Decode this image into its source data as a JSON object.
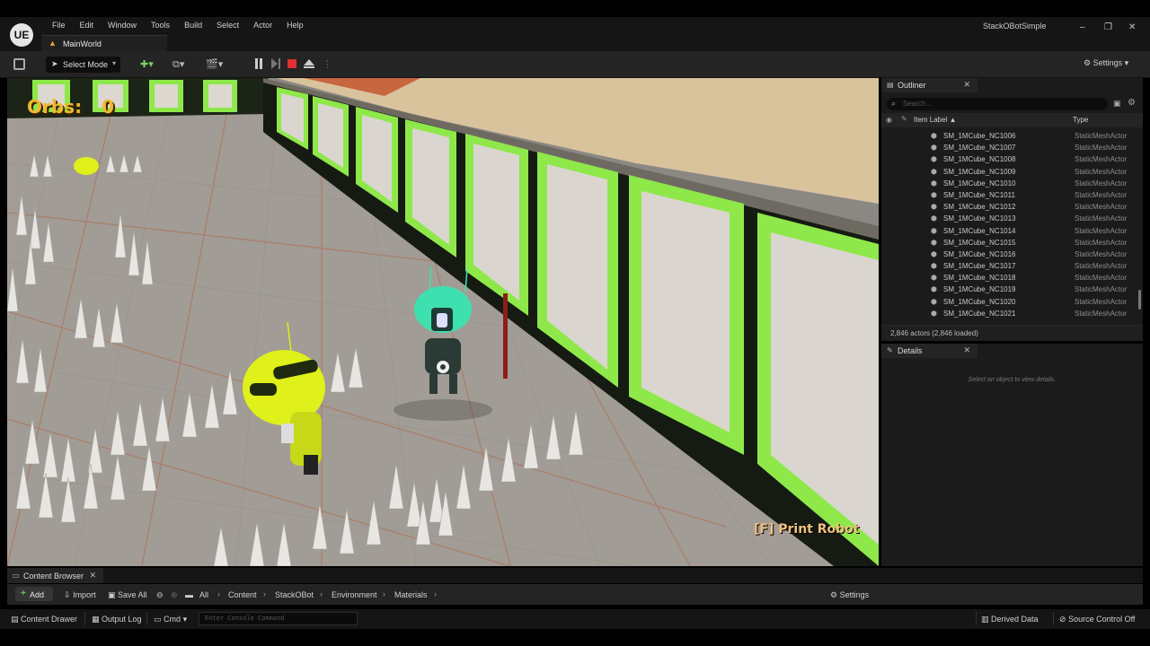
{
  "menubar": {
    "logo": "UE",
    "items": [
      "File",
      "Edit",
      "Window",
      "Tools",
      "Build",
      "Select",
      "Actor",
      "Help"
    ],
    "level_tab": "MainWorld",
    "project_name": "StackOBotSimple"
  },
  "toolbar": {
    "select_mode_label": "Select Mode",
    "settings_label": "Settings"
  },
  "viewport": {
    "orbs_label": "Orbs:",
    "orbs_value": "0",
    "prompt": "[F] Print Robot"
  },
  "outliner": {
    "tab_label": "Outliner",
    "search_placeholder": "Search...",
    "col_label": "Item Label ▲",
    "col_type": "Type",
    "rows": [
      {
        "name": "SM_1MCube_NC1006",
        "type": "StaticMeshActor"
      },
      {
        "name": "SM_1MCube_NC1007",
        "type": "StaticMeshActor"
      },
      {
        "name": "SM_1MCube_NC1008",
        "type": "StaticMeshActor"
      },
      {
        "name": "SM_1MCube_NC1009",
        "type": "StaticMeshActor"
      },
      {
        "name": "SM_1MCube_NC1010",
        "type": "StaticMeshActor"
      },
      {
        "name": "SM_1MCube_NC1011",
        "type": "StaticMeshActor"
      },
      {
        "name": "SM_1MCube_NC1012",
        "type": "StaticMeshActor"
      },
      {
        "name": "SM_1MCube_NC1013",
        "type": "StaticMeshActor"
      },
      {
        "name": "SM_1MCube_NC1014",
        "type": "StaticMeshActor"
      },
      {
        "name": "SM_1MCube_NC1015",
        "type": "StaticMeshActor"
      },
      {
        "name": "SM_1MCube_NC1016",
        "type": "StaticMeshActor"
      },
      {
        "name": "SM_1MCube_NC1017",
        "type": "StaticMeshActor"
      },
      {
        "name": "SM_1MCube_NC1018",
        "type": "StaticMeshActor"
      },
      {
        "name": "SM_1MCube_NC1019",
        "type": "StaticMeshActor"
      },
      {
        "name": "SM_1MCube_NC1020",
        "type": "StaticMeshActor"
      },
      {
        "name": "SM_1MCube_NC1021",
        "type": "StaticMeshActor"
      }
    ],
    "footer": "2,846 actors (2,846 loaded)"
  },
  "details": {
    "tab_label": "Details",
    "empty_text": "Select an object to view details."
  },
  "content_browser": {
    "tab_label": "Content Browser",
    "add_label": "Add",
    "import_label": "Import",
    "save_all_label": "Save All",
    "breadcrumbs": [
      "All",
      "Content",
      "StackOBot",
      "Environment",
      "Materials"
    ],
    "settings_label": "Settings"
  },
  "statusbar": {
    "content_drawer": "Content Drawer",
    "output_log": "Output Log",
    "cmd": "Cmd",
    "console_placeholder": "Enter Console Command",
    "derived_data": "Derived Data",
    "source_control": "Source Control Off"
  },
  "colors": {
    "neon_green": "#8ee84a",
    "hud_orange": "#f0b830",
    "robot_teal": "#3fe0b0",
    "robot_yellow": "#dff01a"
  }
}
